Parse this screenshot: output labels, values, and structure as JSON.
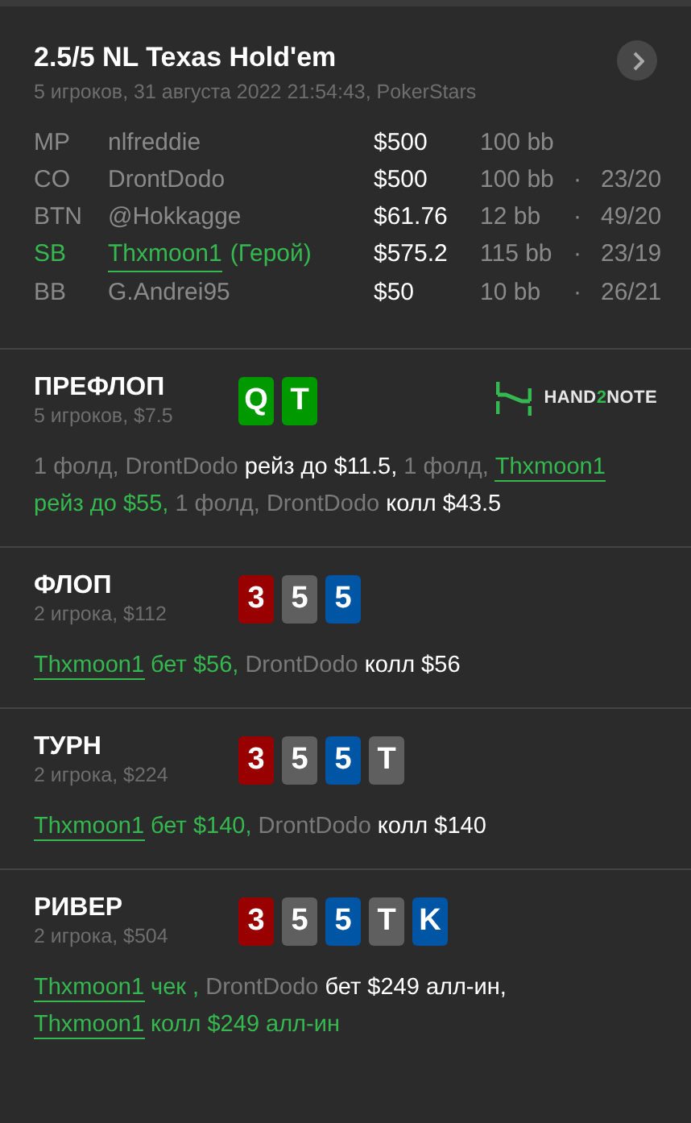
{
  "header": {
    "title": "2.5/5 NL Texas Hold'em",
    "subtitle": "5 игроков, 31 августа 2022 21:54:43, PokerStars"
  },
  "players": [
    {
      "position": "MP",
      "name": "nlfreddie",
      "hero": false,
      "stack": "$500",
      "bb": "100 bb"
    },
    {
      "position": "CO",
      "name": "DrontDodo",
      "hero": false,
      "stack": "$500",
      "bb": "100 bb",
      "separator": "·",
      "stats": "23/20"
    },
    {
      "position": "BTN",
      "name": "@Hokkagge",
      "hero": false,
      "stack": "$61.76",
      "bb": "12 bb",
      "separator": "·",
      "stats": "49/20"
    },
    {
      "position": "SB",
      "name": "Thxmoon1",
      "hero_tag": "(Герой)",
      "hero": true,
      "stack": "$575.2",
      "bb": "115 bb",
      "separator": "·",
      "stats": "23/19"
    },
    {
      "position": "BB",
      "name": "G.Andrei95",
      "hero": false,
      "stack": "$50",
      "bb": "10 bb",
      "separator": "·",
      "stats": "26/21"
    }
  ],
  "logo": {
    "parts": [
      {
        "text": "HAND",
        "accent": false
      },
      {
        "text": "2",
        "accent": true
      },
      {
        "text": "NOTE",
        "accent": false
      }
    ]
  },
  "streets": [
    {
      "title": "ПРЕФЛОП",
      "info": "5 игроков, $7.5",
      "cards": [
        {
          "rank": "Q",
          "color": "#009900"
        },
        {
          "rank": "T",
          "color": "#009900"
        }
      ],
      "actions": [
        {
          "kind": "muted",
          "text": "1 фолд, DrontDodo "
        },
        {
          "kind": "action",
          "text": "рейз до $11.5,"
        },
        {
          "kind": "muted",
          "text": " 1 фолд,"
        },
        {
          "kind": "hero",
          "text": "Thxmoon1"
        },
        {
          "kind": "hero-action",
          "text": " рейз до $55,"
        },
        {
          "kind": "muted",
          "text": " 1 фолд, DrontDodo "
        },
        {
          "kind": "action",
          "text": "колл $43.5"
        }
      ]
    },
    {
      "title": "ФЛОП",
      "info": "2 игрока, $112",
      "cards": [
        {
          "rank": "3",
          "color": "#990000"
        },
        {
          "rank": "5",
          "color": "#5f5f5f"
        },
        {
          "rank": "5",
          "color": "#0055a5"
        }
      ],
      "actions": [
        {
          "kind": "hero",
          "text": "Thxmoon1"
        },
        {
          "kind": "hero-action",
          "text": " бет $56,"
        },
        {
          "kind": "muted",
          "text": " DrontDodo "
        },
        {
          "kind": "action",
          "text": "колл $56"
        }
      ]
    },
    {
      "title": "ТУРН",
      "info": "2 игрока, $224",
      "cards": [
        {
          "rank": "3",
          "color": "#990000"
        },
        {
          "rank": "5",
          "color": "#5f5f5f"
        },
        {
          "rank": "5",
          "color": "#0055a5"
        },
        {
          "rank": "T",
          "color": "#5f5f5f"
        }
      ],
      "actions": [
        {
          "kind": "hero",
          "text": "Thxmoon1"
        },
        {
          "kind": "hero-action",
          "text": " бет $140,"
        },
        {
          "kind": "muted",
          "text": " DrontDodo "
        },
        {
          "kind": "action",
          "text": "колл $140"
        }
      ]
    },
    {
      "title": "РИВЕР",
      "info": "2 игрока, $504",
      "cards": [
        {
          "rank": "3",
          "color": "#990000"
        },
        {
          "rank": "5",
          "color": "#5f5f5f"
        },
        {
          "rank": "5",
          "color": "#0055a5"
        },
        {
          "rank": "T",
          "color": "#5f5f5f"
        },
        {
          "rank": "K",
          "color": "#0055a5"
        }
      ],
      "actions": [
        {
          "kind": "hero",
          "text": "Thxmoon1"
        },
        {
          "kind": "hero-action",
          "text": " чек ,"
        },
        {
          "kind": "muted",
          "text": " DrontDodo "
        },
        {
          "kind": "action",
          "text": "бет $249 алл-ин,"
        },
        {
          "kind": "hero",
          "text": "Thxmoon1"
        },
        {
          "kind": "hero-action",
          "text": " колл $249 алл-ин"
        }
      ]
    }
  ]
}
